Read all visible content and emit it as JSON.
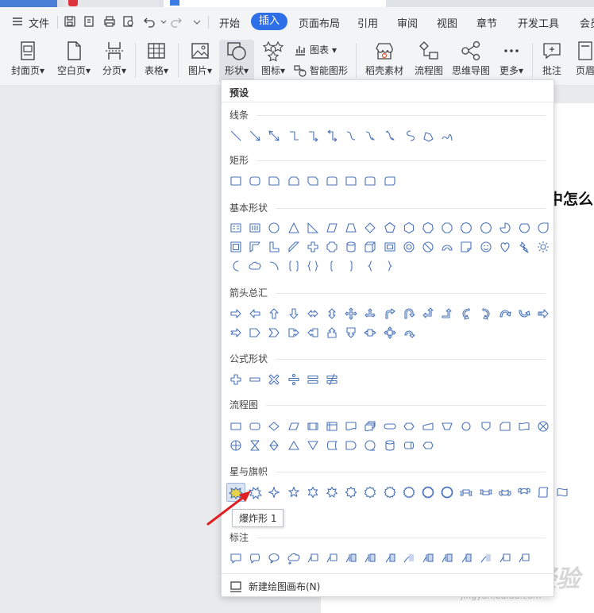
{
  "menubar": {
    "file_label": "文件",
    "tabs": [
      "开始",
      "插入",
      "页面布局",
      "引用",
      "审阅",
      "视图",
      "章节",
      "开发工具",
      "会员"
    ],
    "active_tab": "插入"
  },
  "ribbon": {
    "cover_label": "封面页",
    "blank_label": "空白页",
    "pagebreak_label": "分页",
    "table_label": "表格",
    "picture_label": "图片",
    "shape_label": "形状",
    "icon_label": "图标",
    "chart_label": "图表",
    "smartart_label": "智能图形",
    "material_label": "稻壳素材",
    "flowchart_label": "流程图",
    "mindmap_label": "思维导图",
    "more_label": "更多",
    "comment_label": "批注",
    "header_label": "页眉"
  },
  "document": {
    "visible_text": "中怎么"
  },
  "panel": {
    "title": "预设",
    "categories": [
      "线条",
      "矩形",
      "基本形状",
      "箭头总汇",
      "公式形状",
      "流程图",
      "星与旗帜",
      "标注"
    ],
    "tooltip": "爆炸形 1",
    "footer_label": "新建绘图画布(N)"
  },
  "watermark": {
    "main": "Baidu经验",
    "sub": "jingyan.baidu.com"
  },
  "colors": {
    "accent": "#2e6ee6",
    "shape_stroke": "#4a73b8",
    "arrow": "#e02020"
  }
}
